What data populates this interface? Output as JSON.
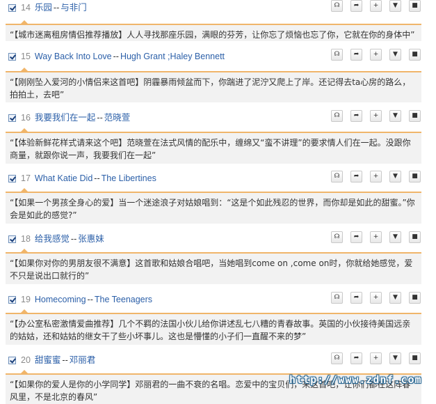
{
  "songs": [
    {
      "num": "14",
      "title": "乐园",
      "sep": "--",
      "artist": "与非门",
      "desc": "“【城市迷离租房情侣推荐播放】人人寻找那座乐园，满眼的芬芳，让你忘了烦恼也忘了你，它就在你的身体中”"
    },
    {
      "num": "15",
      "title": "Way Back Into Love",
      "sep": "--",
      "artist": "Hugh Grant ;Haley Bennett",
      "desc": "“【刚刚坠入爱河的小情侣来这首吧】阴霾暴雨倾盆而下，你踹进了泥泞又爬上了岸。还记得去ta心房的路么，拍拍土，去吧”"
    },
    {
      "num": "16",
      "title": "我要我们在一起",
      "sep": "--",
      "artist": "范晓萱",
      "desc": "“【体验新鲜花样式请来这个吧】范晓萱在法式风情的配乐中，缠绵又“蛮不讲理”的要求情人们在一起。没跟你商量，就跟你说一声，我要我们在一起”"
    },
    {
      "num": "17",
      "title": "What Katie Did",
      "sep": "--",
      "artist": "The Libertines",
      "desc": "“【如果一个男孩全身心的爱】当一个迷途浪子对姑娘唱到：“这是个如此残忍的世界，而你却是如此的甜蜜。”你会是如此的感觉?”"
    },
    {
      "num": "18",
      "title": "给我感觉",
      "sep": "--",
      "artist": "张惠妹",
      "desc": "“【如果你对你的男朋友很不满意】这首歌和姑娘合唱吧，当她唱到come on ,come on时，你就给她感觉，爱不只是说出口就行的”"
    },
    {
      "num": "19",
      "title": "Homecoming",
      "sep": "--",
      "artist": "The Teenagers",
      "desc": "“【办公室私密激情爱曲推荐】几个不羁的法国小伙儿给你讲述乱七八糟的青春故事。英国的小伙接待美国远亲的姑姑，还和姑姑的继女干了些小坏事儿。这也是懵懂的小子们一直醒不来的梦”"
    },
    {
      "num": "20",
      "title": "甜蜜蜜",
      "sep": "--",
      "artist": "邓丽君",
      "desc": "“【如果你的爱人是你的小学同学】邓丽君的一曲不衰的名唱。恋爱中的宝贝们，来这首吧，让你们都在这阵春风里，不是北京的春风”"
    }
  ],
  "actions": {
    "listen": "listen-icon",
    "share": "share-icon",
    "add": "add-icon",
    "download": "download-icon",
    "save": "save-icon"
  },
  "watermark": "http://www.zdnf.com"
}
